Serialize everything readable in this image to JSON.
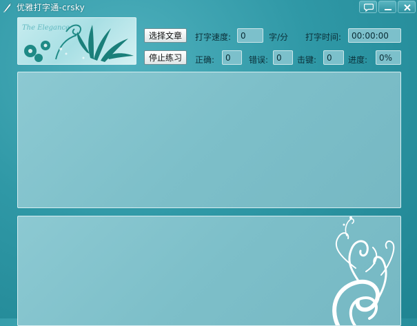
{
  "window": {
    "title": "优雅打字通-crsky",
    "buttons": [
      "chat-icon",
      "minimize-icon",
      "close-icon"
    ]
  },
  "banner": {
    "caption": "The Elegance"
  },
  "buttons": {
    "select_article": "选择文章",
    "stop_practice": "停止练习"
  },
  "stats": {
    "speed_label": "打字速度:",
    "speed_value": "0",
    "speed_unit": "字/分",
    "time_label": "打字时间:",
    "time_value": "00:00:00",
    "correct_label": "正确:",
    "correct_value": "0",
    "error_label": "错误:",
    "error_value": "0",
    "keystroke_label": "击键:",
    "keystroke_value": "0",
    "progress_label": "进度:",
    "progress_value": "0%"
  },
  "colors": {
    "background": "#2f98a6",
    "panel": "#82c3cc",
    "field": "#7cc0cb"
  }
}
